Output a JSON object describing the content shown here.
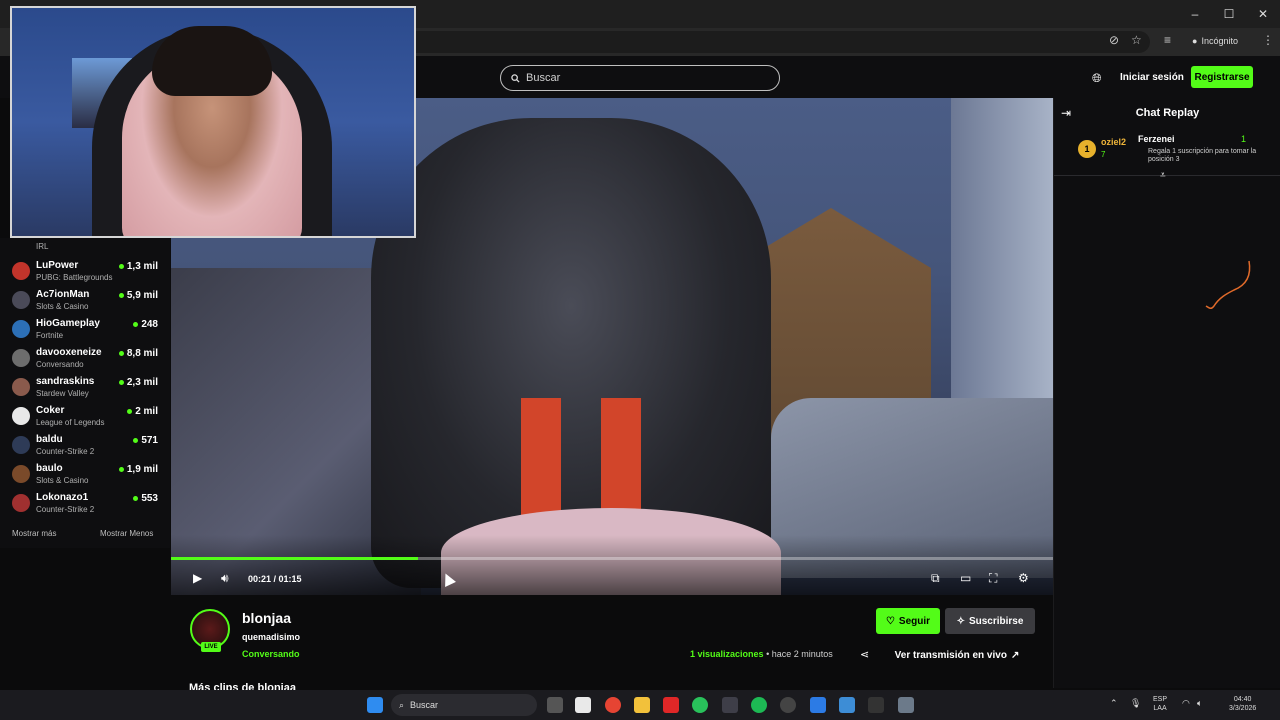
{
  "browser": {
    "incognito_label": "Incógnito",
    "window_controls": [
      "–",
      "☐",
      "✕"
    ]
  },
  "header": {
    "search_placeholder": "Buscar",
    "login_label": "Iniciar sesión",
    "register_label": "Registrarse"
  },
  "sidebar": {
    "top_category": "IRL",
    "channels": [
      {
        "name": "LuPower",
        "category": "PUBG: Battlegrounds",
        "viewers": "1,3 mil"
      },
      {
        "name": "Ac7ionMan",
        "category": "Slots & Casino",
        "viewers": "5,9 mil"
      },
      {
        "name": "HioGameplay",
        "category": "Fortnite",
        "viewers": "248"
      },
      {
        "name": "davooxeneize",
        "category": "Conversando",
        "viewers": "8,8 mil"
      },
      {
        "name": "sandraskins",
        "category": "Stardew Valley",
        "viewers": "2,3 mil"
      },
      {
        "name": "Coker",
        "category": "League of Legends",
        "viewers": "2 mil"
      },
      {
        "name": "baldu",
        "category": "Counter-Strike 2",
        "viewers": "571"
      },
      {
        "name": "baulo",
        "category": "Slots & Casino",
        "viewers": "1,9 mil"
      },
      {
        "name": "Lokonazo1",
        "category": "Counter-Strike 2",
        "viewers": "553"
      }
    ],
    "show_more": "Mostrar más",
    "show_less": "Mostrar Menos"
  },
  "player": {
    "current_time": "00:21",
    "duration": "01:15",
    "progress": 0.28,
    "time_display": "00:21 / 01:15"
  },
  "chat": {
    "title": "Chat Replay",
    "gift": {
      "rank": "1",
      "gifter": "oziel2",
      "gifter_count": "7",
      "recipient": "Ferzenei",
      "recipient_count": "1",
      "message": "Regala 1 suscripción para tomar la posición 3"
    }
  },
  "stream": {
    "username": "blonjaa",
    "title": "quemadisimo",
    "category": "Conversando",
    "live_badge": "LIVE",
    "follow_label": "Seguir",
    "subscribe_label": "Suscribirse",
    "views_count": "1",
    "views_label": "visualizaciones",
    "time_ago": "• hace 2 minutos",
    "vod_label": "Ver transmisión en vivo",
    "more_clips": "Más clips de blonjaa"
  },
  "taskbar": {
    "search_label": "Buscar",
    "language": "ESP",
    "region": "LAA",
    "time": "04:40",
    "date": "3/3/2026"
  }
}
